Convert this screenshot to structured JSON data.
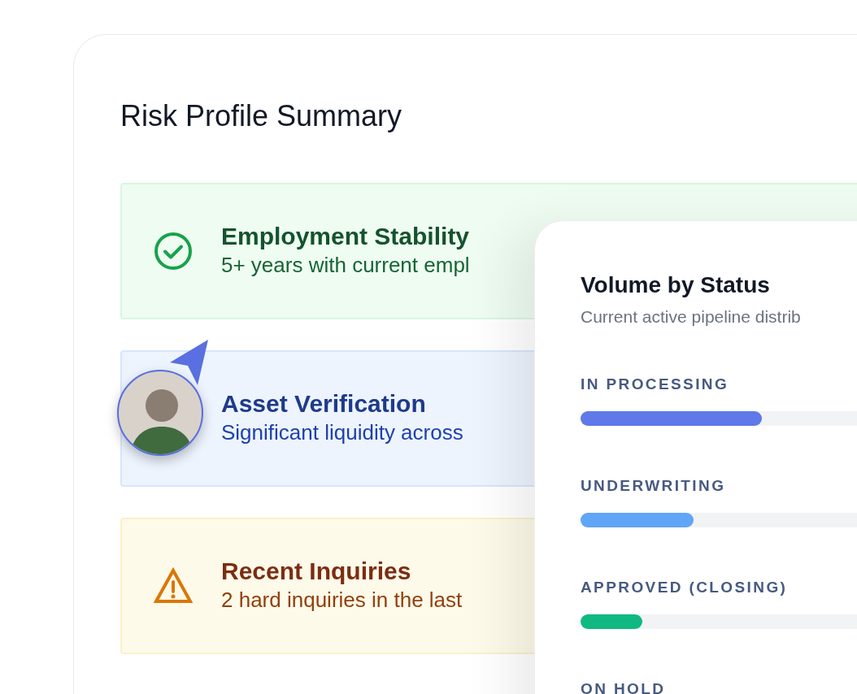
{
  "title": "Risk Profile Summary",
  "factors": [
    {
      "kind": "positive",
      "title": "Employment Stability",
      "detail": "5+ years with current empl"
    },
    {
      "kind": "verified",
      "title": "Asset Verification",
      "detail": "Significant liquidity across"
    },
    {
      "kind": "warning",
      "title": "Recent Inquiries",
      "detail": "2 hard inquiries in the last"
    }
  ],
  "status_card": {
    "title": "Volume by Status",
    "subtitle": "Current active pipeline distrib",
    "statuses": [
      {
        "label": "IN PROCESSING",
        "level": 0.53,
        "color": "#5f79e8"
      },
      {
        "label": "UNDERWRITING",
        "level": 0.33,
        "color": "#60a5f6"
      },
      {
        "label": "APPROVED (CLOSING)",
        "level": 0.18,
        "color": "#10b981"
      },
      {
        "label": "ON HOLD"
      }
    ]
  }
}
